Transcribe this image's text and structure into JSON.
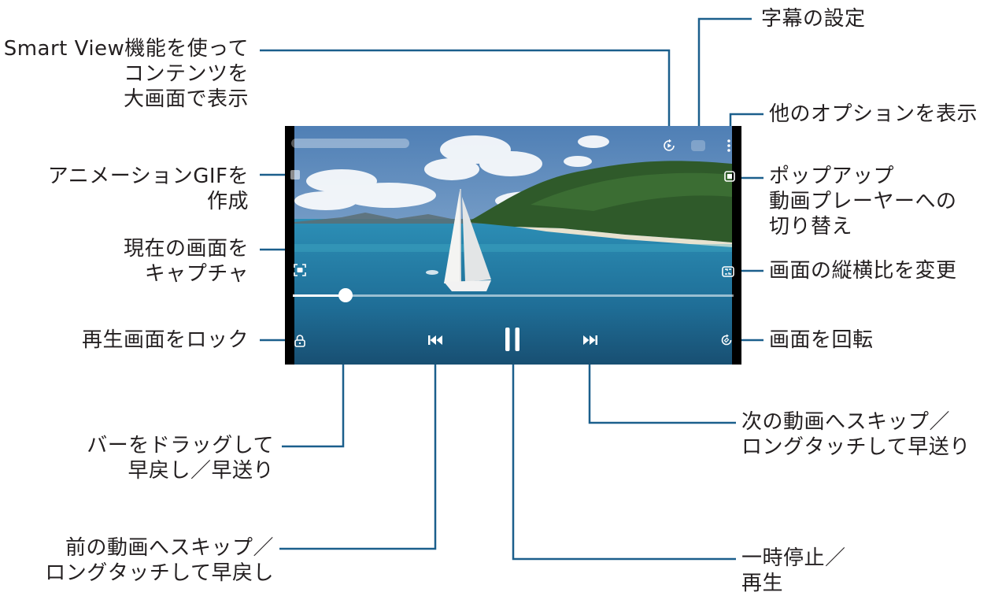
{
  "player": {
    "video_title": "",
    "seek_progress": 0.12
  },
  "callouts": {
    "smart_view": [
      "Smart View機能を使って",
      "コンテンツを",
      "大画面で表示"
    ],
    "subtitle_settings": [
      "字幕の設定"
    ],
    "more_options": [
      "他のオプションを表示"
    ],
    "gif": [
      "アニメーションGIFを",
      "作成"
    ],
    "popup_player": [
      "ポップアップ",
      "動画プレーヤーへの",
      "切り替え"
    ],
    "capture": [
      "現在の画面を",
      "キャプチャ"
    ],
    "aspect_ratio": [
      "画面の縦横比を変更"
    ],
    "lock": [
      "再生画面をロック"
    ],
    "rotate": [
      "画面を回転"
    ],
    "seek_drag": [
      "バーをドラッグして",
      "早戻し／早送り"
    ],
    "next": [
      "次の動画へスキップ／",
      "ロングタッチして早送り"
    ],
    "previous": [
      "前の動画へスキップ／",
      "ロングタッチして早戻し"
    ],
    "pause": [
      "一時停止／",
      "再生"
    ]
  },
  "icons": {
    "smart_view": "smart-view-icon",
    "subtitle": "subtitle-icon",
    "more": "more-options-icon",
    "gif": "gif-icon",
    "popup": "popup-player-icon",
    "capture": "capture-icon",
    "aspect": "aspect-ratio-icon",
    "lock": "lock-icon",
    "rotate": "rotate-icon",
    "previous": "previous-icon",
    "pause": "pause-icon",
    "next": "next-icon"
  },
  "colors": {
    "callout_line": "#1b5f8c",
    "text": "#231f20"
  }
}
